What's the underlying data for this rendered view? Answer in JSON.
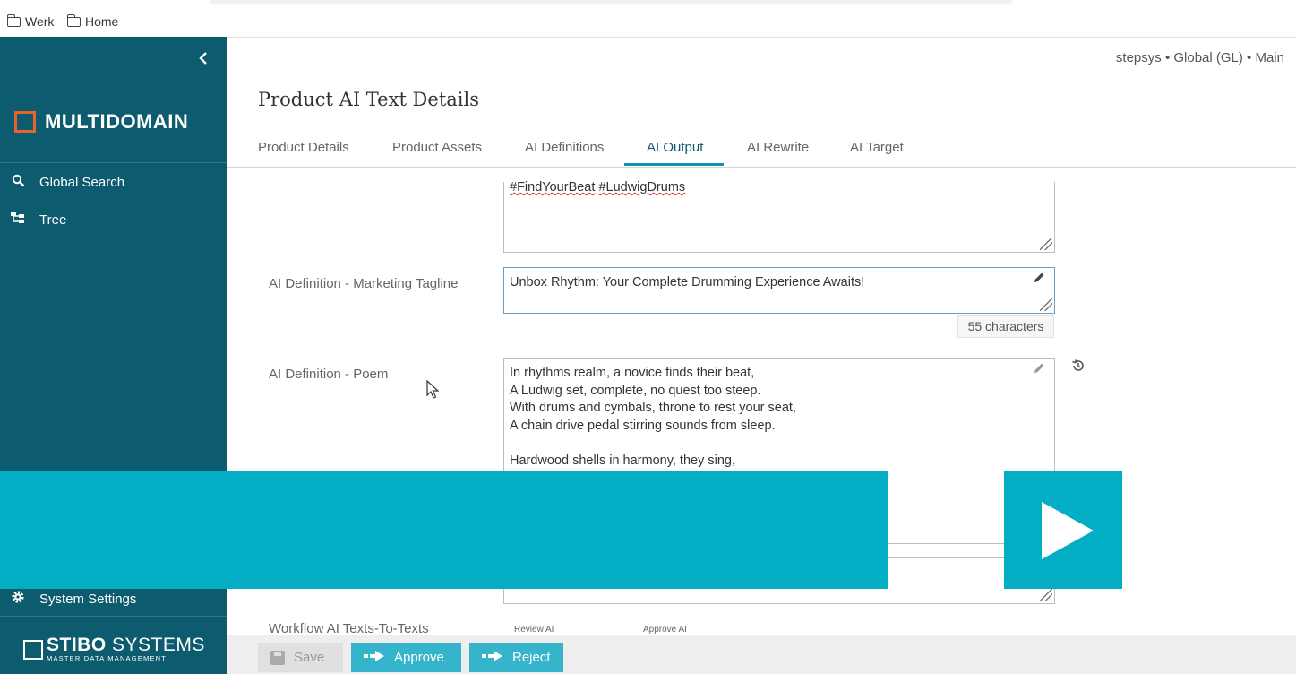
{
  "bookmarks": [
    {
      "label": "Werk",
      "icon": "folder-icon"
    },
    {
      "label": "Home",
      "icon": "folder-icon"
    }
  ],
  "sidebar": {
    "collapse_icon": "chevron-left-icon",
    "brand": "MULTIDOMAIN",
    "brand_color": "#e8632c",
    "nav": [
      {
        "label": "Global Search",
        "icon": "search-icon"
      },
      {
        "label": "Tree",
        "icon": "tree-icon"
      }
    ],
    "settings": {
      "label": "System Settings",
      "icon": "gear-icon"
    },
    "footer": {
      "bold": "STIBO",
      "rest": "SYSTEMS",
      "tagline": "MASTER DATA MANAGEMENT"
    },
    "background": "#0d5b6e"
  },
  "context": "stepsys • Global (GL) • Main",
  "page_title": "Product AI Text Details",
  "tabs": [
    "Product Details",
    "Product Assets",
    "AI Definitions",
    "AI Output",
    "AI Rewrite",
    "AI Target"
  ],
  "active_tab": "AI Output",
  "fields": {
    "hashtags": {
      "value_a": "#FindYourBeat",
      "value_b": "#LudwigDrums"
    },
    "tagline": {
      "label": "AI Definition - Marketing Tagline",
      "value": "Unbox Rhythm: Your Complete Drumming Experience Awaits!",
      "counter": "55 characters"
    },
    "poem": {
      "label": "AI Definition - Poem",
      "value": "In rhythms realm, a novice finds their beat,\nA Ludwig set, complete, no quest too steep.\nWith drums and cymbals, throne to rest your seat,\nA chain drive pedal stirring sounds from sleep.\n\nHardwood shells in harmony, they sing,"
    }
  },
  "workflow": {
    "label": "Workflow AI Texts-To-Texts",
    "states": [
      "Review AI",
      "Approve AI"
    ]
  },
  "actions": {
    "save": "Save",
    "approve": "Approve",
    "reject": "Reject"
  },
  "overlay": {
    "icon": "play-icon",
    "color": "#03aec4"
  }
}
